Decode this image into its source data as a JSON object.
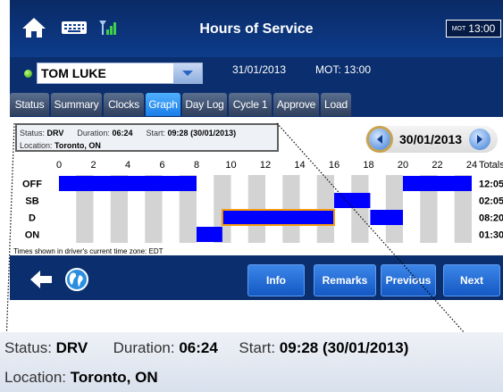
{
  "header": {
    "title": "Hours of Service",
    "mot_small": "MOT",
    "mot_time": "13:00",
    "icons": [
      "home-icon",
      "keyboard-icon",
      "signal-icon"
    ]
  },
  "driver": {
    "name": "TOM LUKE",
    "date": "31/01/2013",
    "mot": "MOT: 13:00"
  },
  "tabs": [
    {
      "label": "Status"
    },
    {
      "label": "Summary"
    },
    {
      "label": "Clocks"
    },
    {
      "label": "Graph"
    },
    {
      "label": "Day Log"
    },
    {
      "label": "Cycle 1"
    },
    {
      "label": "Approve"
    },
    {
      "label": "Load"
    }
  ],
  "active_tab": "Graph",
  "status": {
    "status_label": "Status:",
    "status_value": "DRV",
    "duration_label": "Duration:",
    "duration_value": "06:24",
    "start_label": "Start:",
    "start_value": "09:28 (30/01/2013)",
    "location_label": "Location:",
    "location_value": "Toronto, ON"
  },
  "date_nav": {
    "date": "30/01/2013"
  },
  "graph": {
    "hour_labels": [
      "0",
      "2",
      "4",
      "6",
      "8",
      "10",
      "12",
      "14",
      "16",
      "18",
      "20",
      "22",
      "24"
    ],
    "totals_label": "Totals",
    "rows": [
      {
        "label": "OFF",
        "total": "12:05"
      },
      {
        "label": "SB",
        "total": "02:05"
      },
      {
        "label": "D",
        "total": "08:20"
      },
      {
        "label": "ON",
        "total": "01:30"
      }
    ],
    "segments": [
      {
        "row": 0,
        "start": 0,
        "end": 8
      },
      {
        "row": 3,
        "start": 8,
        "end": 9.5
      },
      {
        "row": 2,
        "start": 9.5,
        "end": 16
      },
      {
        "row": 1,
        "start": 16,
        "end": 18.1
      },
      {
        "row": 2,
        "start": 18.1,
        "end": 20
      },
      {
        "row": 0,
        "start": 20,
        "end": 24
      }
    ],
    "highlight_segment": 2,
    "colors": {
      "bar": "#0000ff",
      "highlight": "#f39c12",
      "shade": "#d3d3d3"
    }
  },
  "timezone_note": "Times shown in driver's current time zone: EDT",
  "toolbar": {
    "info": "Info",
    "remarks": "Remarks",
    "previous": "Previous",
    "next": "Next",
    "icons": [
      "back-arrow-icon",
      "globe-icon"
    ]
  }
}
